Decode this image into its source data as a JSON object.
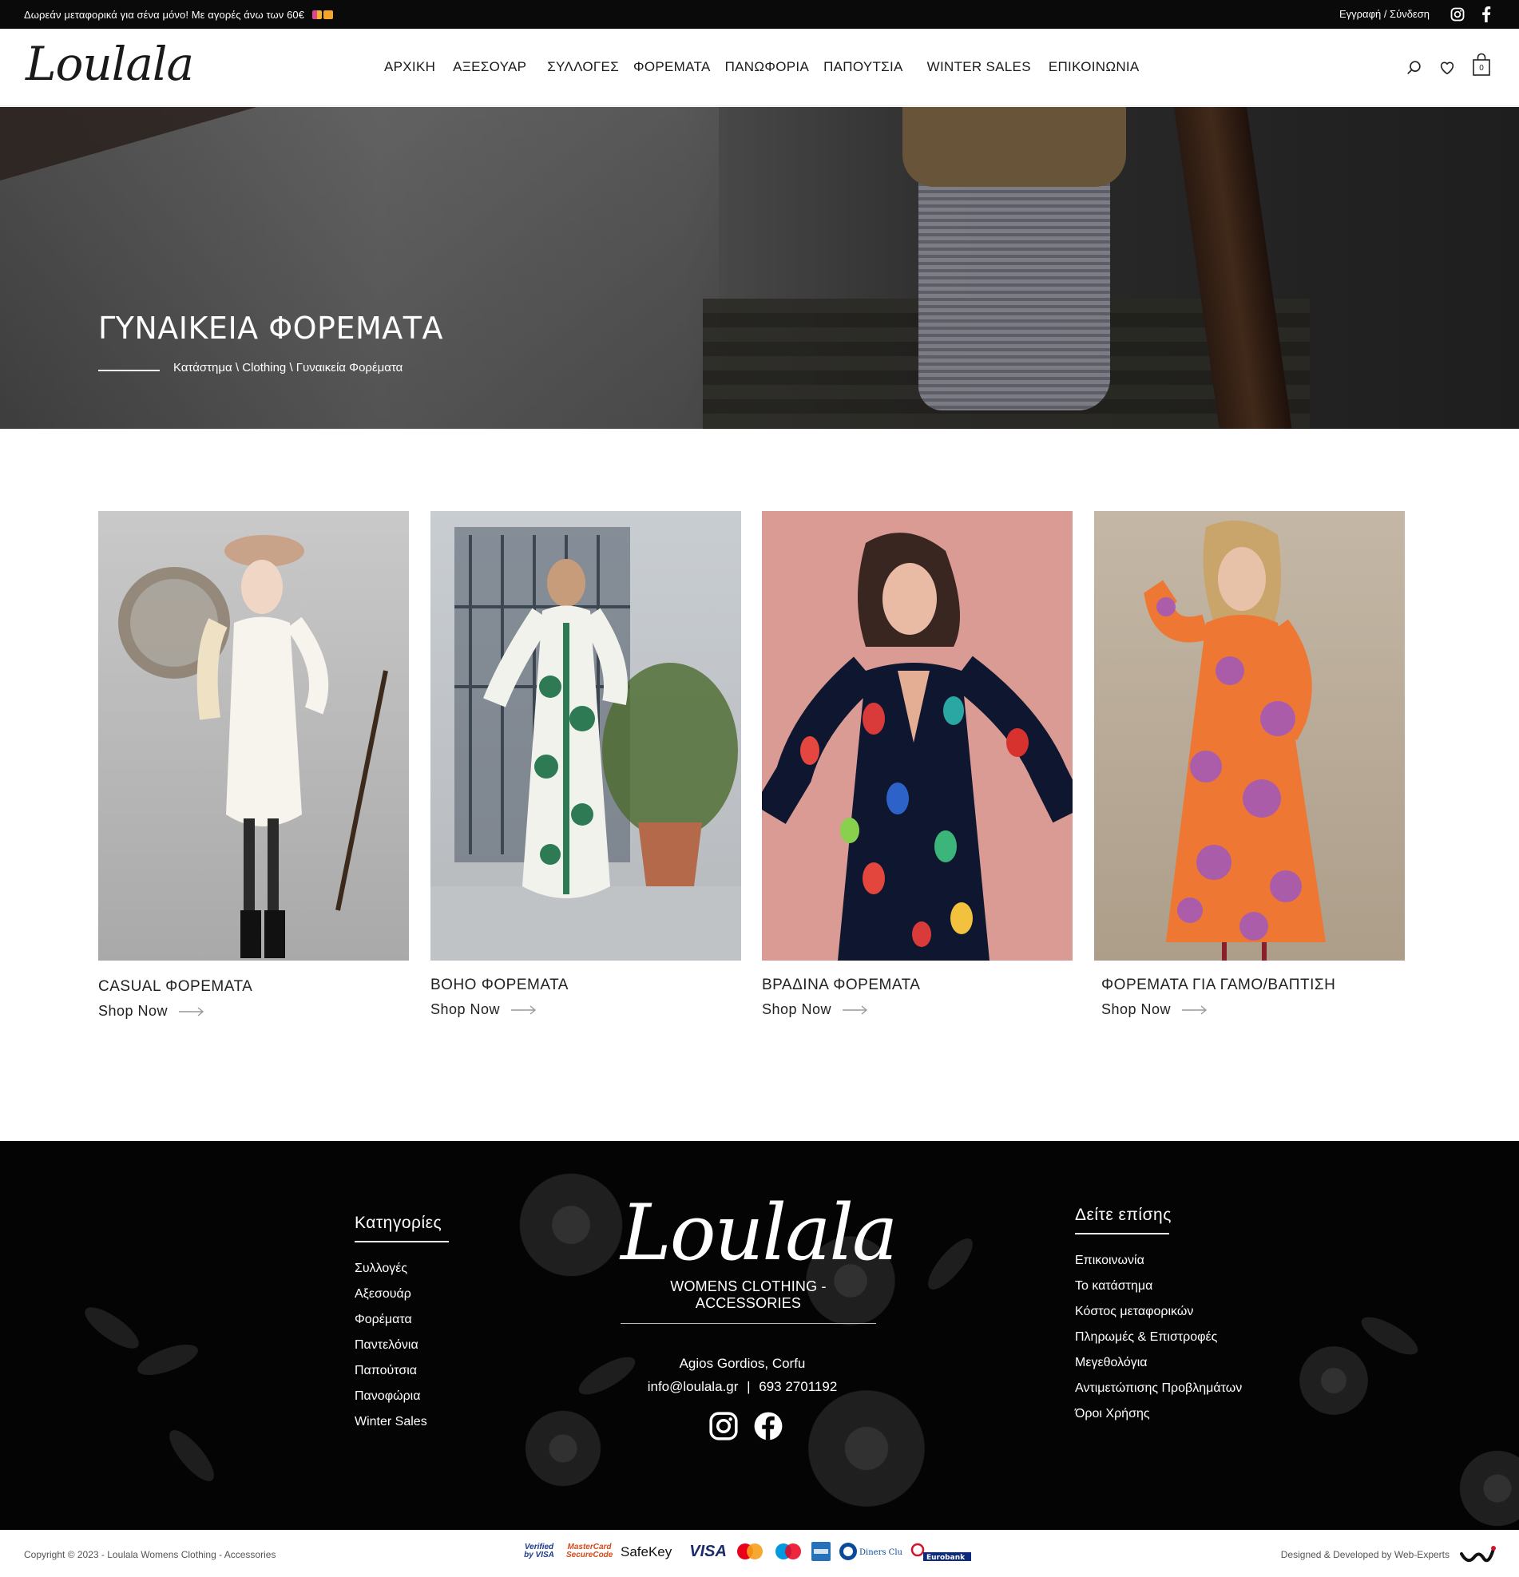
{
  "topbar": {
    "promo": "Δωρεάν μεταφορικά για σένα μόνο! Με αγορές άνω των 60€",
    "account": "Εγγραφή / Σύνδεση",
    "icons": [
      "instagram-icon",
      "facebook-icon"
    ]
  },
  "header": {
    "logo": "Loulala",
    "nav": [
      "ΑΡΧΙΚΗ",
      "ΑΞΕΣΟΥΑΡ",
      "ΣΥΛΛΟΓΕΣ",
      "ΦΟΡΕΜΑΤΑ",
      "ΠΑΝΩΦΟΡΙΑ",
      "ΠΑΠΟΥΤΣΙΑ",
      "WINTER SALES",
      "ΕΠΙΚΟΙΝΩΝΙΑ"
    ],
    "cart_count": "0",
    "icons": [
      "search-icon",
      "heart-icon",
      "bag-icon"
    ]
  },
  "hero": {
    "title": "ΓΥΝΑΙΚΕΙΑ ΦΟΡΕΜΑΤΑ",
    "breadcrumb": [
      "Κατάστημα",
      "Clothing",
      "Γυναικεία Φορέματα"
    ],
    "breadcrumb_sep": " \\ "
  },
  "categories": [
    {
      "title": "CASUAL ΦΟΡΕΜΑΤΑ",
      "cta": "Shop Now"
    },
    {
      "title": "BOHO ΦΟΡΕΜΑΤΑ",
      "cta": "Shop Now"
    },
    {
      "title": "ΒΡΑΔΙΝΑ ΦΟΡΕΜΑΤΑ",
      "cta": "Shop Now"
    },
    {
      "title": "ΦΟΡΕΜΑΤΑ ΓΙΑ ΓΑΜΟ/ΒΑΠΤΙΣΗ",
      "cta": "Shop Now"
    }
  ],
  "footer": {
    "categories_title": "Κατηγορίες",
    "categories": [
      "Συλλογές",
      "Αξεσουάρ",
      "Φορέματα",
      "Παντελόνια",
      "Παπούτσια",
      "Πανοφώρια",
      "Winter Sales"
    ],
    "logo": "Loulala",
    "tagline": "WOMENS CLOTHING - ACCESSORIES",
    "address": "Agios Gordios, Corfu",
    "email": "info@loulala.gr",
    "separator": "|",
    "phone": "693 2701192",
    "see_also_title": "Δείτε επίσης",
    "see_also": [
      "Επικοινωνία",
      "Το κατάστημα",
      "Κόστος μεταφορικών",
      "Πληρωμές & Επιστροφές",
      "Μεγεθολόγια",
      "Αντιμετώπισης Προβλημάτων",
      "Όροι Χρήσης"
    ]
  },
  "bottom": {
    "copyright": "Copyright © 2023 -  Loulala Womens Clothing - Accessories",
    "payments": [
      "Verified by VISA",
      "MasterCard SecureCode",
      "SafeKey",
      "VISA",
      "MasterCard",
      "Maestro",
      "AMEX",
      "Diners Club",
      "Eurobank"
    ],
    "designed_by": "Designed &  Developed by Web-Experts"
  }
}
